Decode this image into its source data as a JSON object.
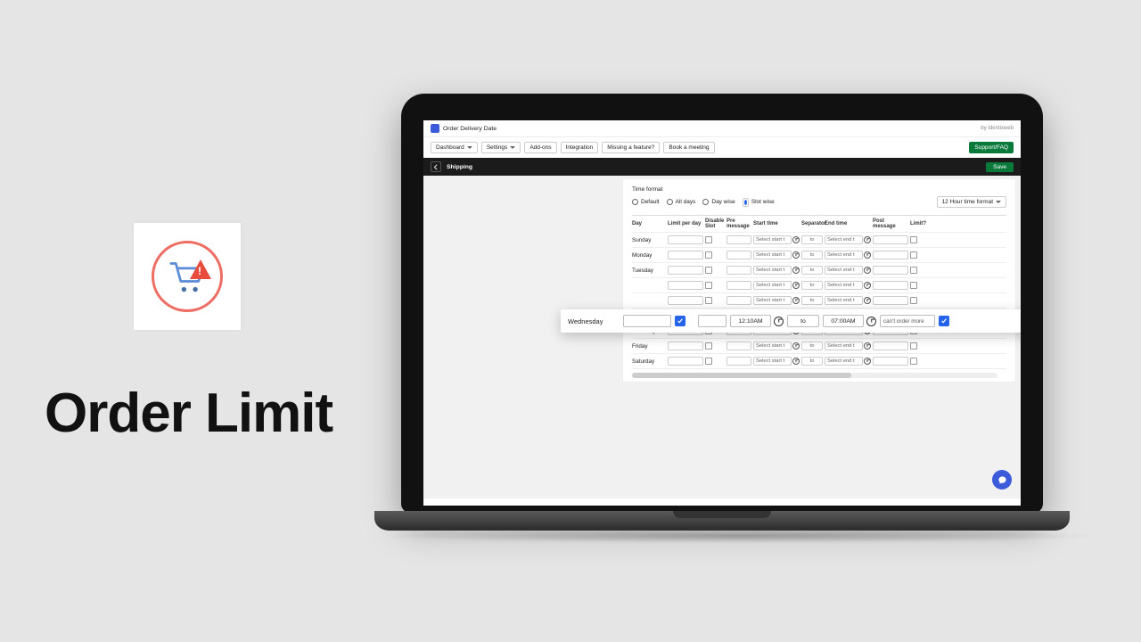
{
  "marketing": {
    "title": "Order Limit"
  },
  "header": {
    "app_name": "Order Delivery Date",
    "byline": "by Identixweb"
  },
  "toolbar": {
    "dashboard": "Dashboard",
    "settings": "Settings",
    "addons": "Add-ons",
    "integration": "Integration",
    "missing": "Missing a feature?",
    "book": "Book a meeting",
    "support": "Support/FAQ"
  },
  "pagehead": {
    "title": "Shipping",
    "save": "Save"
  },
  "section": {
    "time_format_label": "Time format",
    "radios": {
      "default": "Default",
      "alldays": "All days",
      "daywise": "Day wise",
      "slotwise": "Slot wise"
    },
    "format_btn": "12 Hour time format"
  },
  "columns": {
    "day": "Day",
    "limit": "Limit per day",
    "disable": "Disable Slot",
    "pre": "Pre message",
    "start": "Start time",
    "sep": "Separator",
    "end": "End time",
    "post": "Post message",
    "limitq": "Limit?"
  },
  "placeholders": {
    "select_start": "Select start t",
    "select_end": "Select end t",
    "to": "to"
  },
  "days": {
    "sunday": "Sunday",
    "monday": "Monday",
    "tuesday": "Tuesday",
    "wednesday": "Wednesday",
    "thursday": "Thursday",
    "friday": "Friday",
    "saturday": "Saturday"
  },
  "highlight": {
    "day": "Wednesday",
    "disable_checked": true,
    "start": "12:10AM",
    "sep": "to",
    "end": "07:00AM",
    "post": "can't order more",
    "limit_checked": true
  }
}
